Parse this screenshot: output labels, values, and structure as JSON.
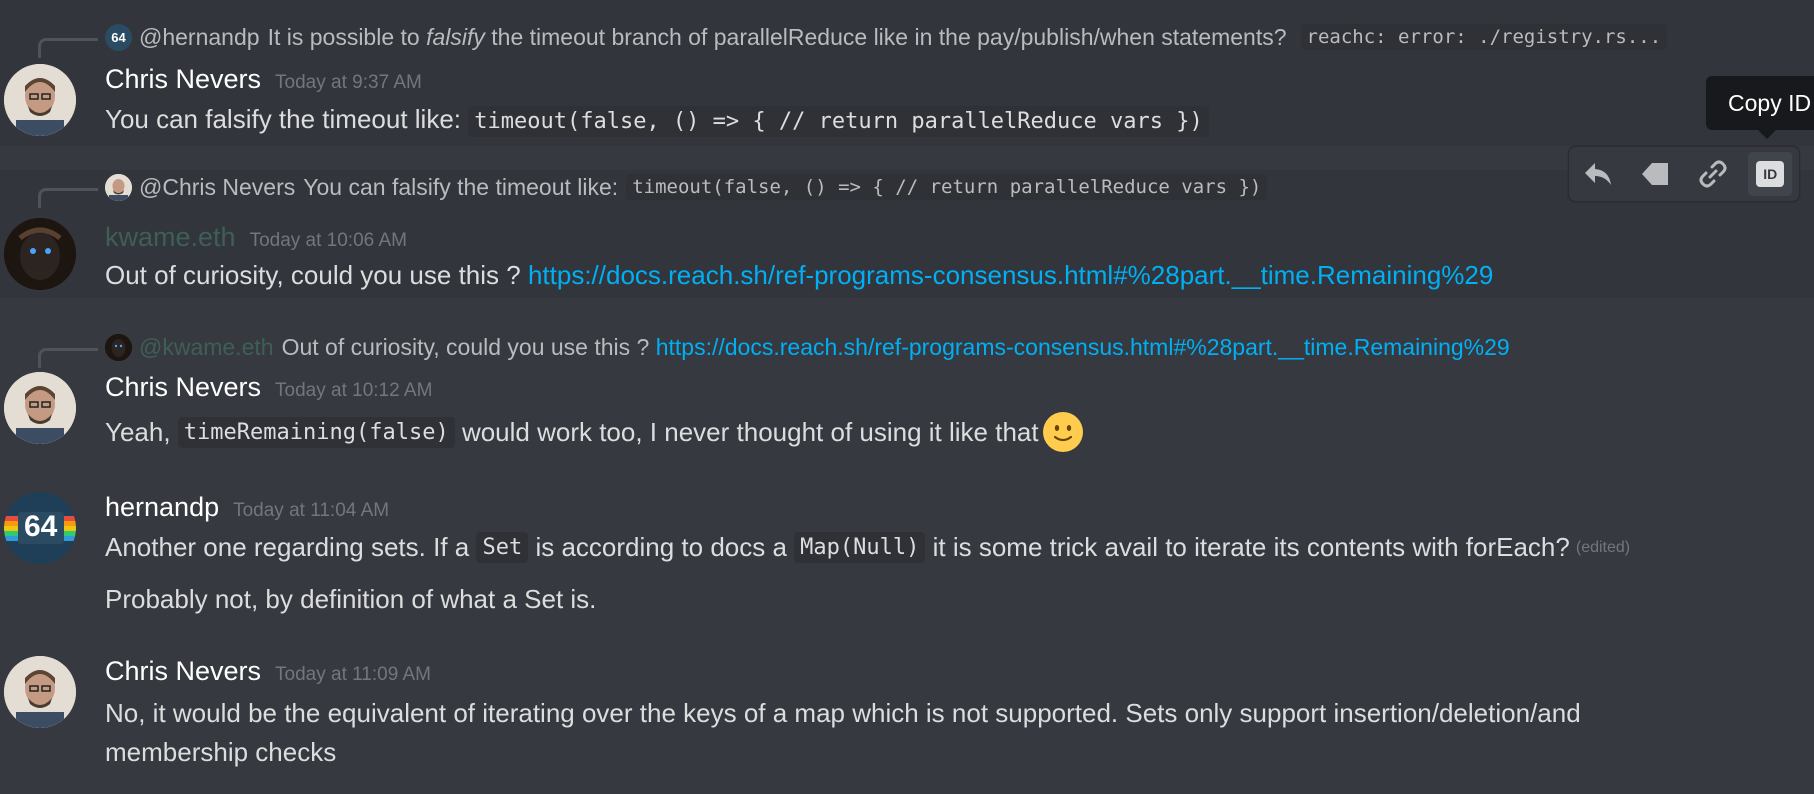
{
  "messages": [
    {
      "reply": {
        "author": "@hernandp",
        "text_before": "It is possible to",
        "text_italic": "falsify",
        "text_after": "the timeout branch of parallelReduce like in the pay/publish/when  statements?",
        "code": "reachc: error: ./registry.rs..."
      },
      "author": "Chris Nevers",
      "timestamp": "Today at 9:37 AM",
      "text": "You can falsify the timeout like:",
      "code": "timeout(false, () => { // return parallelReduce vars })"
    },
    {
      "reply": {
        "author": "@Chris Nevers",
        "text": "You can falsify the timeout like:",
        "code": "timeout(false, () => { // return parallelReduce vars })"
      },
      "author": "kwame.eth",
      "timestamp": "Today at 10:06 AM",
      "text": "Out of curiosity, could you use this ?",
      "link": "https://docs.reach.sh/ref-programs-consensus.html#%28part.__time.Remaining%29"
    },
    {
      "reply": {
        "author": "@kwame.eth",
        "text": "Out of curiosity, could you use this ?",
        "link": "https://docs.reach.sh/ref-programs-consensus.html#%28part.__time.Remaining%29"
      },
      "author": "Chris Nevers",
      "timestamp": "Today at 10:12 AM",
      "text_before": "Yeah,",
      "code": "timeRemaining(false)",
      "text_after": "would work too, I never thought of using it like that"
    },
    {
      "author": "hernandp",
      "timestamp": "Today at 11:04 AM",
      "text_1": "Another one regarding sets.  If a",
      "code_1": "Set",
      "text_2": "is according to docs a",
      "code_2": "Map(Null)",
      "text_3": " it is some trick avail to iterate its contents with forEach?",
      "edited": "(edited)",
      "followup": "Probably not, by definition of what a Set is."
    },
    {
      "author": "Chris Nevers",
      "timestamp": "Today at 11:09 AM",
      "text": "No, it would be the equivalent of iterating over the keys of a map which is not supported. Sets only support insertion/deletion/and membership checks"
    }
  ],
  "avatars": {
    "hernandp_badge": "64"
  },
  "toolbar": {
    "id_label": "ID",
    "tooltip": "Copy ID"
  },
  "colors": {
    "link": "#00aff4",
    "background": "#36393f",
    "dim_username": "#3f5f56"
  }
}
